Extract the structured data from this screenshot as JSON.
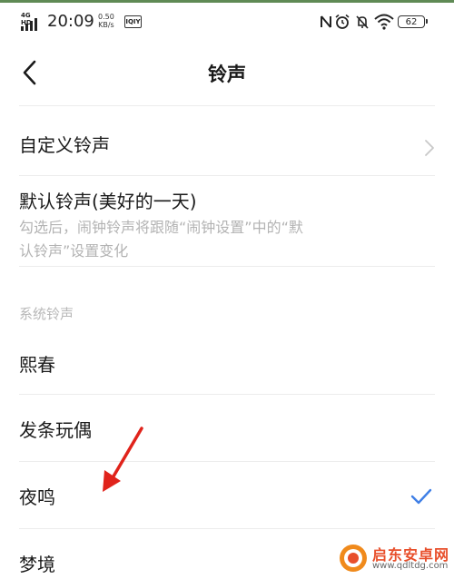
{
  "status_bar": {
    "network": "4G HD",
    "time": "20:09",
    "speed_value": "0.50",
    "speed_unit": "KB/s",
    "sim_label": "IQIY",
    "battery": "62",
    "icons": [
      "nfc-icon",
      "alarm-icon",
      "mute-bell-icon",
      "wifi-icon",
      "battery-icon"
    ]
  },
  "header": {
    "title": "铃声",
    "back_icon": "chevron-left-icon"
  },
  "items": {
    "custom": {
      "label": "自定义铃声",
      "icon": "chevron-right-icon"
    },
    "default": {
      "label": "默认铃声(美好的一天)",
      "desc_line1": "勾选后，闹钟铃声将跟随“闹钟设置”中的“默",
      "desc_line2": "认铃声”设置变化"
    }
  },
  "system_section": {
    "header": "系统铃声",
    "ringtones": [
      {
        "label": "熙春",
        "selected": false
      },
      {
        "label": "发条玩偶",
        "selected": false
      },
      {
        "label": "夜鸣",
        "selected": true
      },
      {
        "label": "梦境",
        "selected": false
      }
    ]
  },
  "watermark": {
    "title": "启东安卓网",
    "url": "www.qdltdg.com"
  },
  "colors": {
    "accent_check": "#3f7fe6",
    "annotation_arrow": "#e0231b",
    "secondary_text": "#b3b3b3"
  }
}
